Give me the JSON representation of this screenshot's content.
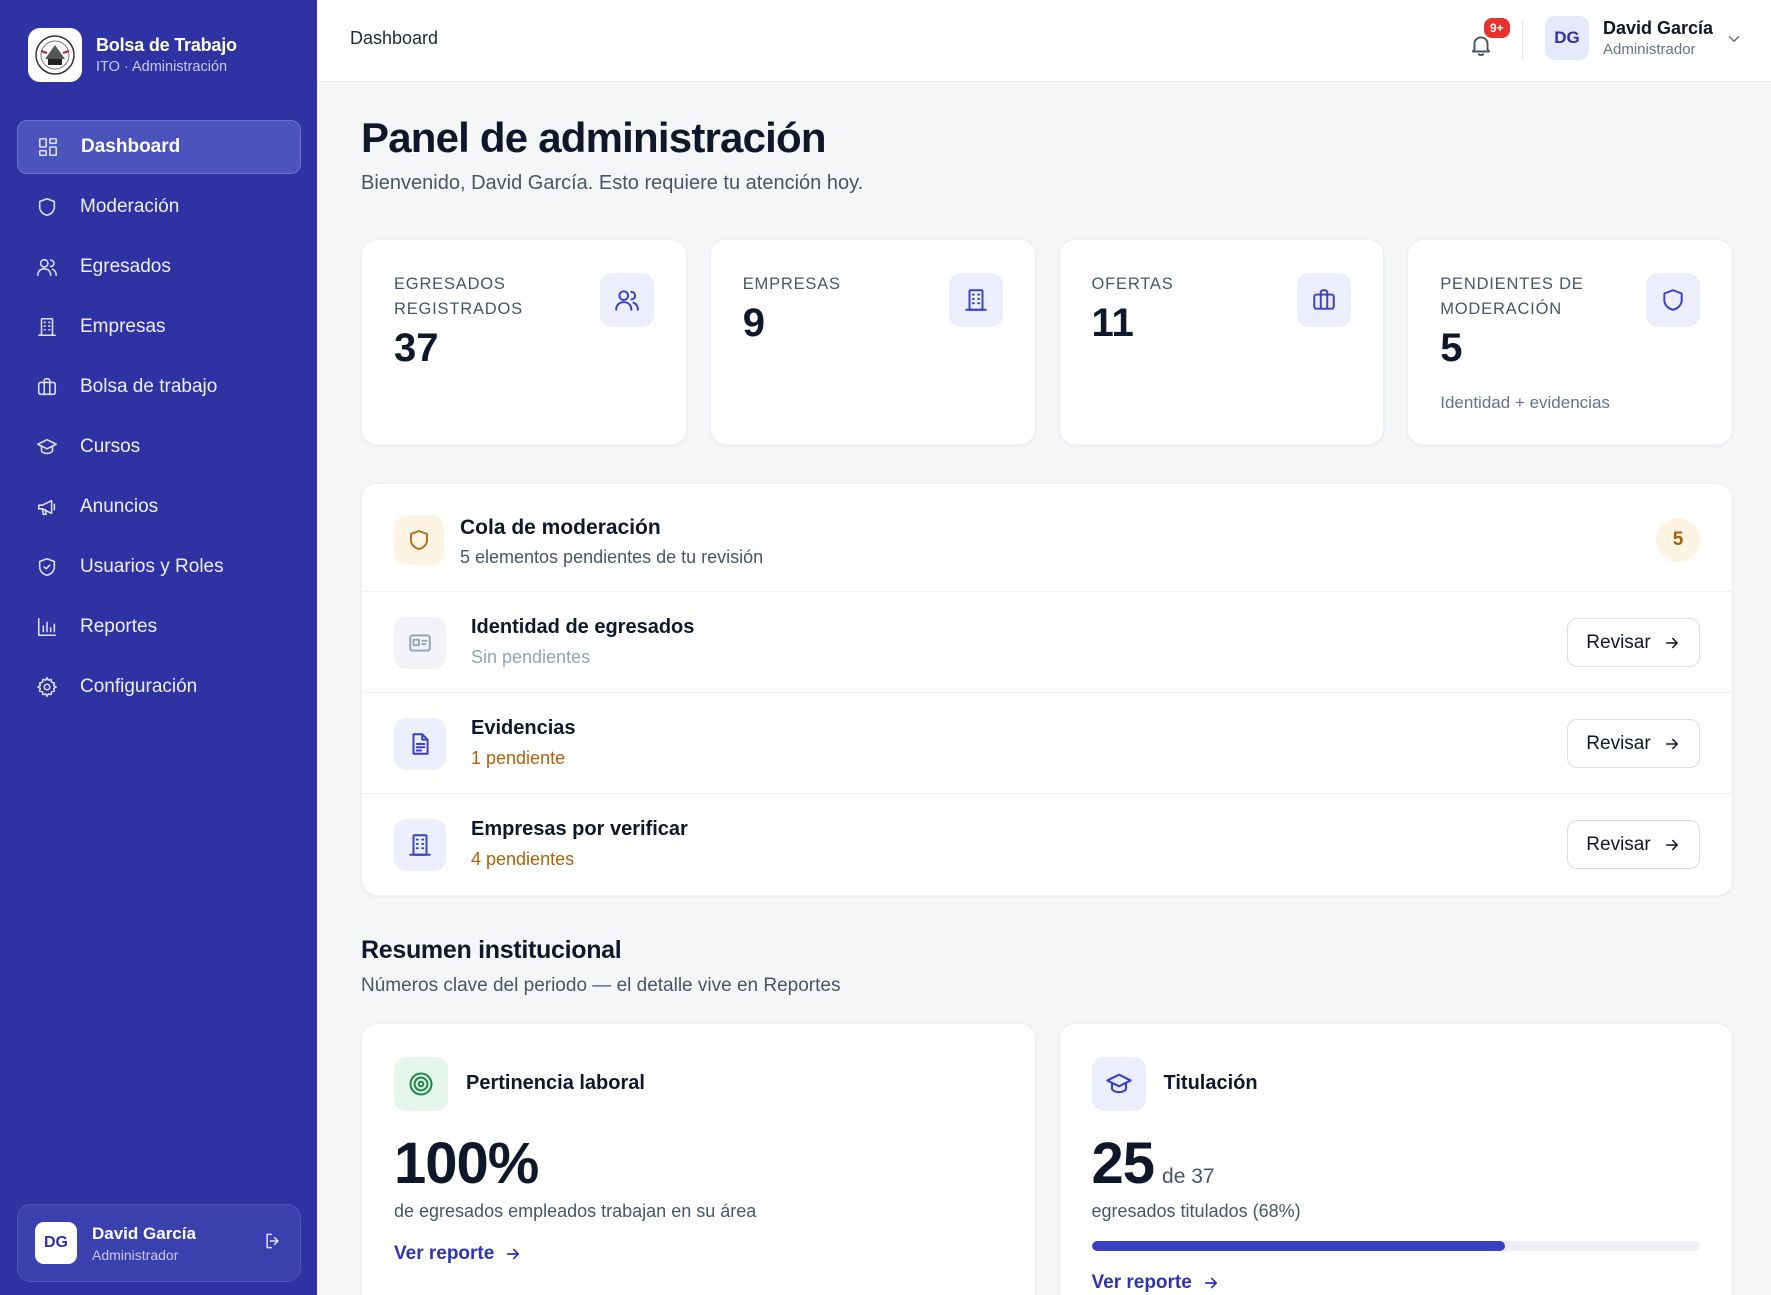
{
  "brand": {
    "title": "Bolsa de Trabajo",
    "subtitle": "ITO · Administración"
  },
  "sidebar": {
    "items": [
      {
        "label": "Dashboard",
        "icon": "dashboard-icon",
        "active": true
      },
      {
        "label": "Moderación",
        "icon": "shield-icon"
      },
      {
        "label": "Egresados",
        "icon": "users-icon"
      },
      {
        "label": "Empresas",
        "icon": "building-icon"
      },
      {
        "label": "Bolsa de trabajo",
        "icon": "briefcase-icon"
      },
      {
        "label": "Cursos",
        "icon": "graduation-cap-icon"
      },
      {
        "label": "Anuncios",
        "icon": "megaphone-icon"
      },
      {
        "label": "Usuarios y Roles",
        "icon": "shield-check-icon"
      },
      {
        "label": "Reportes",
        "icon": "bar-chart-icon"
      },
      {
        "label": "Configuración",
        "icon": "gear-icon"
      }
    ],
    "user": {
      "initials": "DG",
      "name": "David García",
      "role": "Administrador"
    }
  },
  "topbar": {
    "breadcrumb": "Dashboard",
    "notifications_badge": "9+",
    "user": {
      "initials": "DG",
      "name": "David García",
      "role": "Administrador"
    }
  },
  "page": {
    "title": "Panel de administración",
    "subtitle": "Bienvenido, David García. Esto requiere tu atención hoy."
  },
  "stats": [
    {
      "label": "Egresados registrados",
      "value": "37",
      "note": "",
      "icon": "users-icon"
    },
    {
      "label": "Empresas",
      "value": "9",
      "note": "",
      "icon": "building-icon"
    },
    {
      "label": "Ofertas",
      "value": "11",
      "note": "",
      "icon": "briefcase-icon"
    },
    {
      "label": "Pendientes de moderación",
      "value": "5",
      "note": "Identidad + evidencias",
      "icon": "shield-icon"
    }
  ],
  "queue": {
    "title": "Cola de moderación",
    "subtitle": "5 elementos pendientes de tu revisión",
    "count": "5",
    "rows": [
      {
        "title": "Identidad de egresados",
        "status": "Sin pendientes",
        "button": "Revisar",
        "icon": "id-card-icon"
      },
      {
        "title": "Evidencias",
        "status": "1 pendiente",
        "button": "Revisar",
        "icon": "document-icon"
      },
      {
        "title": "Empresas por verificar",
        "status": "4 pendientes",
        "button": "Revisar",
        "icon": "building-icon"
      }
    ]
  },
  "summary": {
    "title": "Resumen institucional",
    "subtitle": "Números clave del periodo — el detalle vive en Reportes",
    "cards": [
      {
        "title": "Pertinencia laboral",
        "value": "100%",
        "value_suffix": "",
        "description": "de egresados empleados trabajan en su área",
        "link": "Ver reporte",
        "icon": "target-icon"
      },
      {
        "title": "Titulación",
        "value": "25",
        "value_suffix": "de 37",
        "description": "egresados titulados (68%)",
        "link": "Ver reporte",
        "icon": "graduation-cap-icon",
        "progress": 0.68
      }
    ]
  },
  "colors": {
    "sidebar": "#2e32a2",
    "accent": "#3b3fc4",
    "warning": "#b45f0a",
    "badge": "#e5322d",
    "success": "#1f8a4c"
  }
}
